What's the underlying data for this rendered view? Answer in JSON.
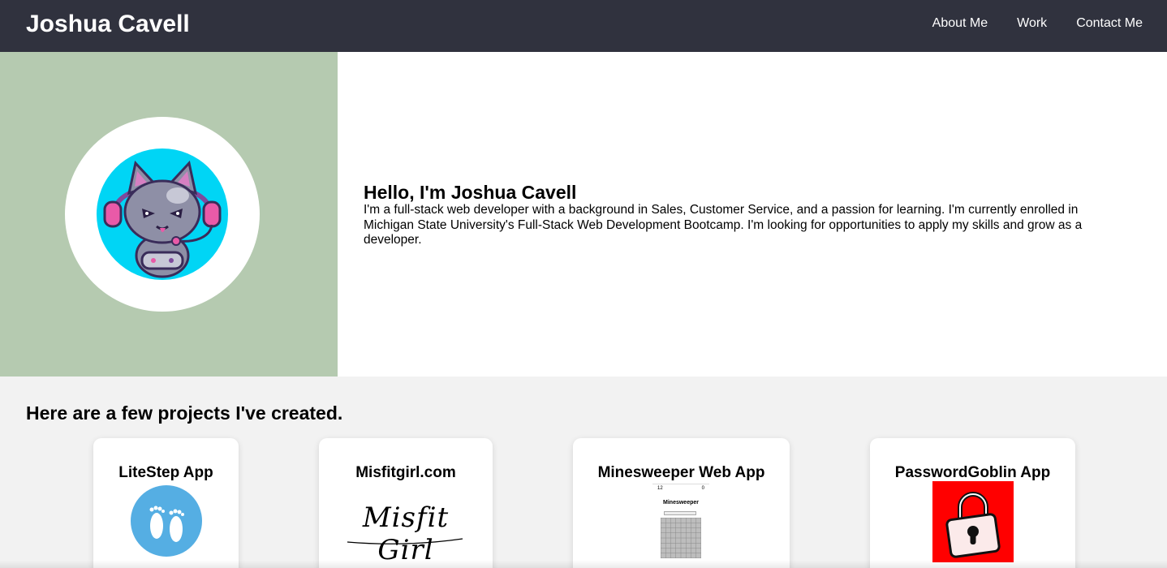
{
  "header": {
    "brand": "Joshua Cavell",
    "nav": [
      "About Me",
      "Work",
      "Contact Me"
    ]
  },
  "hero": {
    "title": "Hello, I'm Joshua Cavell",
    "body": "I'm a full-stack web developer with a background in Sales, Customer Service, and a passion for learning. I'm currently enrolled in Michigan State University's Full-Stack Web Development Bootcamp. I'm looking for opportunities to apply my skills and grow as a developer."
  },
  "projects": {
    "heading": "Here are a few projects I've created.",
    "cards": [
      {
        "title": "LiteStep App"
      },
      {
        "title": "Misfitgirl.com",
        "logo_text": "Misfit Girl"
      },
      {
        "title": "Minesweeper Web App",
        "thumb_title": "Minesweeper",
        "thumb_left": "12",
        "thumb_right": "0"
      },
      {
        "title": "PasswordGoblin App"
      }
    ]
  },
  "colors": {
    "navbar": "#30323e",
    "hero_left": "#b5cab0",
    "litestep": "#55aee3",
    "password": "#ff0000"
  }
}
